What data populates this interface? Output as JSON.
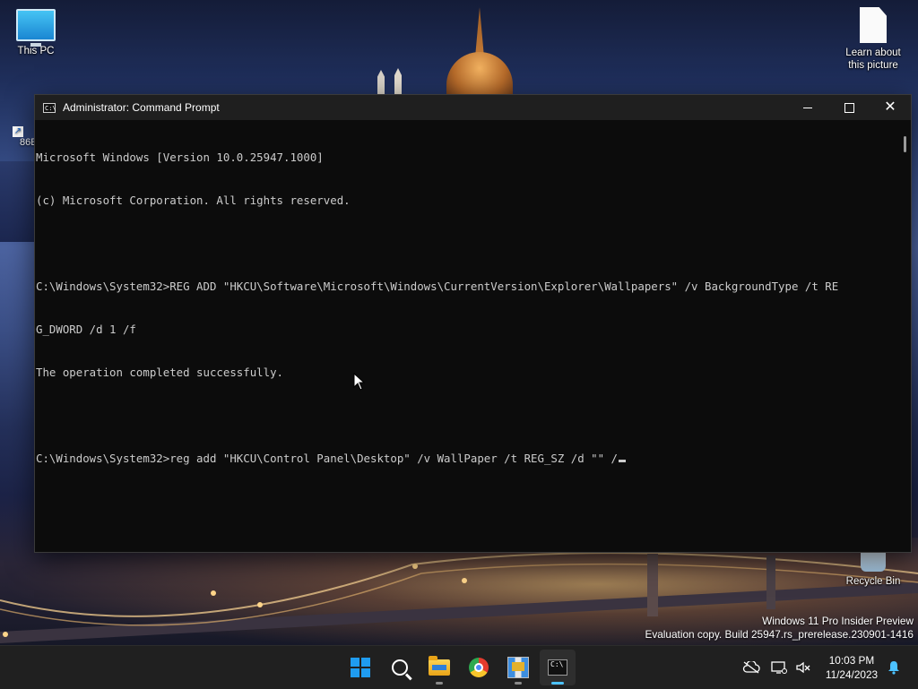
{
  "desktop": {
    "icons": [
      {
        "label": "This PC",
        "icon": "monitor-icon"
      },
      {
        "label": "Learn about this picture",
        "icon": "document-icon"
      },
      {
        "label": "Recycle Bin",
        "icon": "recycle-bin-icon"
      }
    ],
    "shortcut_fragment": "86E"
  },
  "window": {
    "title": "Administrator: Command Prompt",
    "controls": {
      "minimize": "minimize",
      "maximize": "maximize",
      "close": "close"
    },
    "console_lines": [
      "Microsoft Windows [Version 10.0.25947.1000]",
      "(c) Microsoft Corporation. All rights reserved.",
      "",
      "C:\\Windows\\System32>REG ADD \"HKCU\\Software\\Microsoft\\Windows\\CurrentVersion\\Explorer\\Wallpapers\" /v BackgroundType /t RE",
      "G_DWORD /d 1 /f",
      "The operation completed successfully.",
      "",
      "C:\\Windows\\System32>reg add \"HKCU\\Control Panel\\Desktop\" /v WallPaper /t REG_SZ /d \"\" /"
    ]
  },
  "watermark": {
    "line1": "Windows 11 Pro Insider Preview",
    "line2": "Evaluation copy. Build 25947.rs_prerelease.230901-1416"
  },
  "taskbar": {
    "apps": [
      {
        "name": "start",
        "icon": "windows-start-icon"
      },
      {
        "name": "search",
        "icon": "search-icon"
      },
      {
        "name": "file-explorer",
        "icon": "folder-icon"
      },
      {
        "name": "chrome",
        "icon": "chrome-icon"
      },
      {
        "name": "registry-editor",
        "icon": "regedit-icon"
      },
      {
        "name": "command-prompt",
        "icon": "terminal-icon"
      }
    ],
    "tray": {
      "time": "10:03 PM",
      "date": "11/24/2023"
    }
  },
  "colors": {
    "accent": "#4cc2ff",
    "console_bg": "#0c0c0c",
    "console_text": "#cccccc",
    "taskbar_bg": "#202020"
  }
}
